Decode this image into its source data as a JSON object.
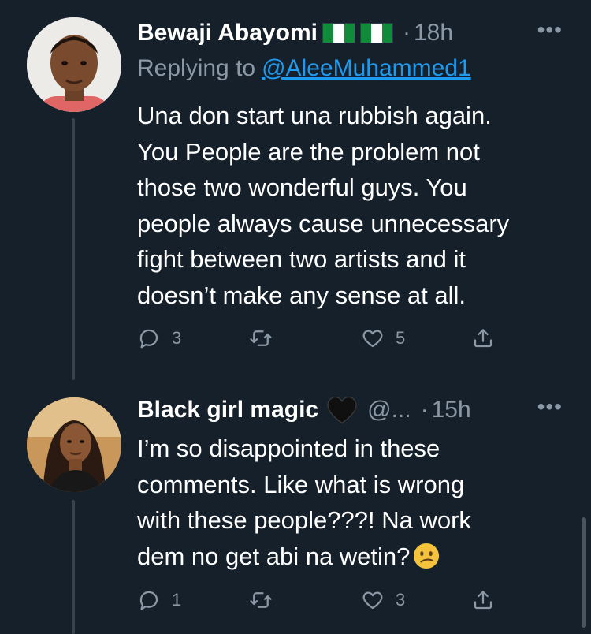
{
  "tweets": [
    {
      "author": "Bewaji Abayomi",
      "time": "18h",
      "replying_prefix": "Replying to",
      "replying_to": "@AleeMuhammed1",
      "text": "Una don start una rubbish again.\nYou People are the problem not\nthose two wonderful guys. You\npeople always cause unnecessary\nfight between two artists and it\ndoesn’t make any sense at all.",
      "replies": "3",
      "likes": "5"
    },
    {
      "author": "Black girl magic",
      "handle": "@...",
      "time": "15h",
      "text": "I’m so disappointed in these\ncomments. Like what is wrong\nwith these people???! Na work\ndem no get abi na wetin?",
      "replies": "1",
      "likes": "3"
    }
  ],
  "icons": {
    "flag": "nigeria-flag-icon",
    "heart": "black-heart-icon",
    "emoji": "confused-face-icon",
    "more": "more-icon",
    "reply": "reply-icon",
    "retweet": "retweet-icon",
    "like": "like-icon",
    "share": "share-icon"
  },
  "colors": {
    "background": "#15202b",
    "secondary_text": "#8b98a5",
    "link": "#1d9bf0",
    "flag_green": "#118a3a"
  },
  "glyphs": {
    "dot": "·",
    "more": "•••"
  }
}
